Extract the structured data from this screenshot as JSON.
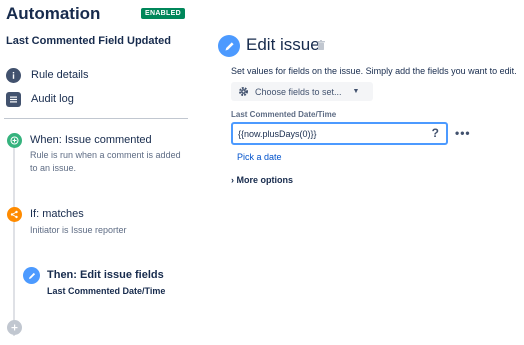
{
  "header": {
    "title": "Automation",
    "status_badge": "ENABLED"
  },
  "sidebar": {
    "rule_name": "Last Commented Field Updated",
    "nav": [
      {
        "label": "Rule details",
        "icon": "info-icon"
      },
      {
        "label": "Audit log",
        "icon": "audit-log-icon"
      }
    ],
    "steps": [
      {
        "title": "When: Issue commented",
        "description_line1": "Rule is run when a comment is added",
        "description_line2": "to an issue.",
        "icon": "trigger-plus-icon",
        "color": "#36b37e"
      },
      {
        "title": "If: matches",
        "description": "Initiator is Issue reporter",
        "icon": "condition-branch-icon",
        "color": "#ff8b00"
      },
      {
        "title": "Then: Edit issue fields",
        "description": "Last Commented Date/Time",
        "icon": "pencil-icon",
        "color": "#4c9aff"
      }
    ],
    "add_step_icon": "add-icon"
  },
  "main": {
    "title": "Edit issue",
    "description": "Set values for fields on the issue. Simply add the fields you want to edit.",
    "choose_fields_label": "Choose fields to set...",
    "field_label": "Last Commented Date/Time",
    "field_value": "{{now.plusDays(0)}}",
    "help_label": "?",
    "more_actions_label": "•••",
    "pick_date_label": "Pick a date",
    "more_options_label": "More options"
  }
}
